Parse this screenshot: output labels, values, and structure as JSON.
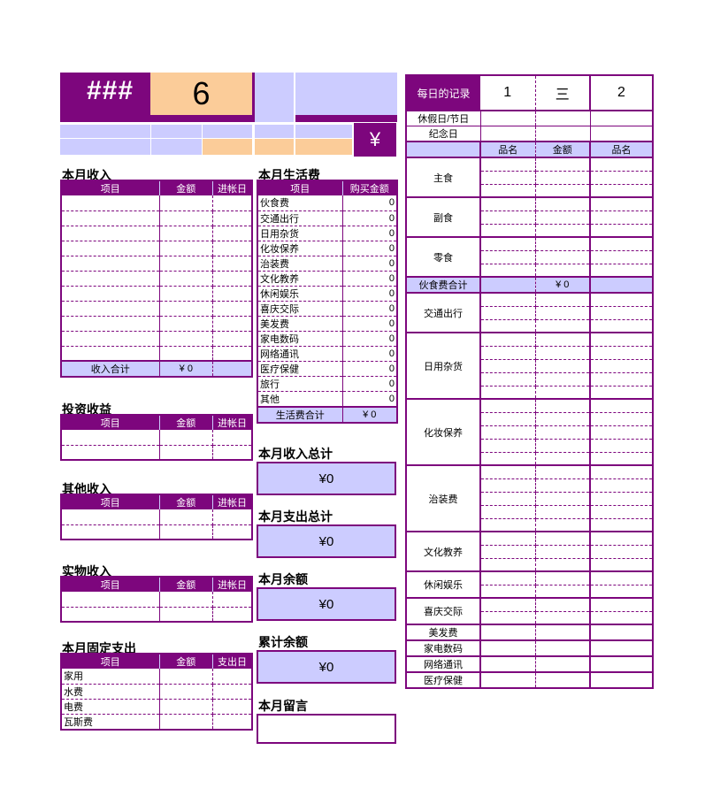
{
  "theme": {
    "purple": "#7D067D",
    "lavender": "#CCCCFF",
    "peach": "#FBCC99",
    "white": "#FFFFFF"
  },
  "banner": {
    "overflow_marker": "###",
    "month_number": "6",
    "currency_symbol": "¥"
  },
  "income": {
    "caption": "本月收入",
    "columns": [
      "项目",
      "金额",
      "进帐日"
    ],
    "row_count": 11,
    "total_label": "收入合计",
    "total_value": "¥ 0"
  },
  "investment": {
    "caption": "投资收益",
    "columns": [
      "项目",
      "金额",
      "进帐日"
    ],
    "row_count": 2
  },
  "other_income": {
    "caption": "其他收入",
    "columns": [
      "项目",
      "金额",
      "进帐日"
    ],
    "row_count": 2
  },
  "material_income": {
    "caption": "实物收入",
    "columns": [
      "项目",
      "金额",
      "进帐日"
    ],
    "row_count": 2
  },
  "fixed_expense": {
    "caption": "本月固定支出",
    "columns": [
      "项目",
      "金额",
      "支出日"
    ],
    "rows": [
      {
        "item": "家用",
        "amount": "",
        "date": ""
      },
      {
        "item": "水费",
        "amount": "",
        "date": ""
      },
      {
        "item": "电费",
        "amount": "",
        "date": ""
      },
      {
        "item": "瓦斯费",
        "amount": "",
        "date": ""
      }
    ]
  },
  "living_expense": {
    "caption": "本月生活费",
    "columns": [
      "项目",
      "购买金额"
    ],
    "rows": [
      {
        "item": "伙食费",
        "amount": "0"
      },
      {
        "item": "交通出行",
        "amount": "0"
      },
      {
        "item": "日用杂货",
        "amount": "0"
      },
      {
        "item": "化妆保养",
        "amount": "0"
      },
      {
        "item": "治装费",
        "amount": "0"
      },
      {
        "item": "文化教养",
        "amount": "0"
      },
      {
        "item": "休闲娱乐",
        "amount": "0"
      },
      {
        "item": "喜庆交际",
        "amount": "0"
      },
      {
        "item": "美发费",
        "amount": "0"
      },
      {
        "item": "家电数码",
        "amount": "0"
      },
      {
        "item": "网络通讯",
        "amount": "0"
      },
      {
        "item": "医疗保健",
        "amount": "0"
      },
      {
        "item": "旅行",
        "amount": "0"
      },
      {
        "item": "其他",
        "amount": "0"
      }
    ],
    "total_label": "生活费合计",
    "total_value": "¥ 0"
  },
  "summary": {
    "boxes": [
      {
        "caption": "本月收入总计",
        "value": "¥0"
      },
      {
        "caption": "本月支出总计",
        "value": "¥0"
      },
      {
        "caption": "本月余额",
        "value": "¥0"
      },
      {
        "caption": "累计余额",
        "value": "¥0"
      }
    ],
    "memo_caption": "本月留言",
    "memo_value": ""
  },
  "daily_record": {
    "title": "每日的记录",
    "day_columns": [
      "1",
      "三",
      "2"
    ],
    "holiday_label": "休假日/节日",
    "anniversary_label": "纪念日",
    "sub_headers": [
      "品名",
      "金额",
      "品名"
    ],
    "categories": [
      {
        "name": "主食",
        "sub_rows": 3
      },
      {
        "name": "副食",
        "sub_rows": 3
      },
      {
        "name": "零食",
        "sub_rows": 3
      },
      {
        "name": "伙食费合计",
        "sub_rows": 0,
        "is_total": true,
        "total_value": "¥ 0"
      },
      {
        "name": "交通出行",
        "sub_rows": 3
      },
      {
        "name": "日用杂货",
        "sub_rows": 5
      },
      {
        "name": "化妆保养",
        "sub_rows": 5
      },
      {
        "name": "治装费",
        "sub_rows": 5
      },
      {
        "name": "文化教养",
        "sub_rows": 3
      },
      {
        "name": "休闲娱乐",
        "sub_rows": 2
      },
      {
        "name": "喜庆交际",
        "sub_rows": 2
      },
      {
        "name": "美发费",
        "sub_rows": 1
      },
      {
        "name": "家电数码",
        "sub_rows": 1
      },
      {
        "name": "网络通讯",
        "sub_rows": 1
      },
      {
        "name": "医疗保健",
        "sub_rows": 1
      }
    ]
  }
}
